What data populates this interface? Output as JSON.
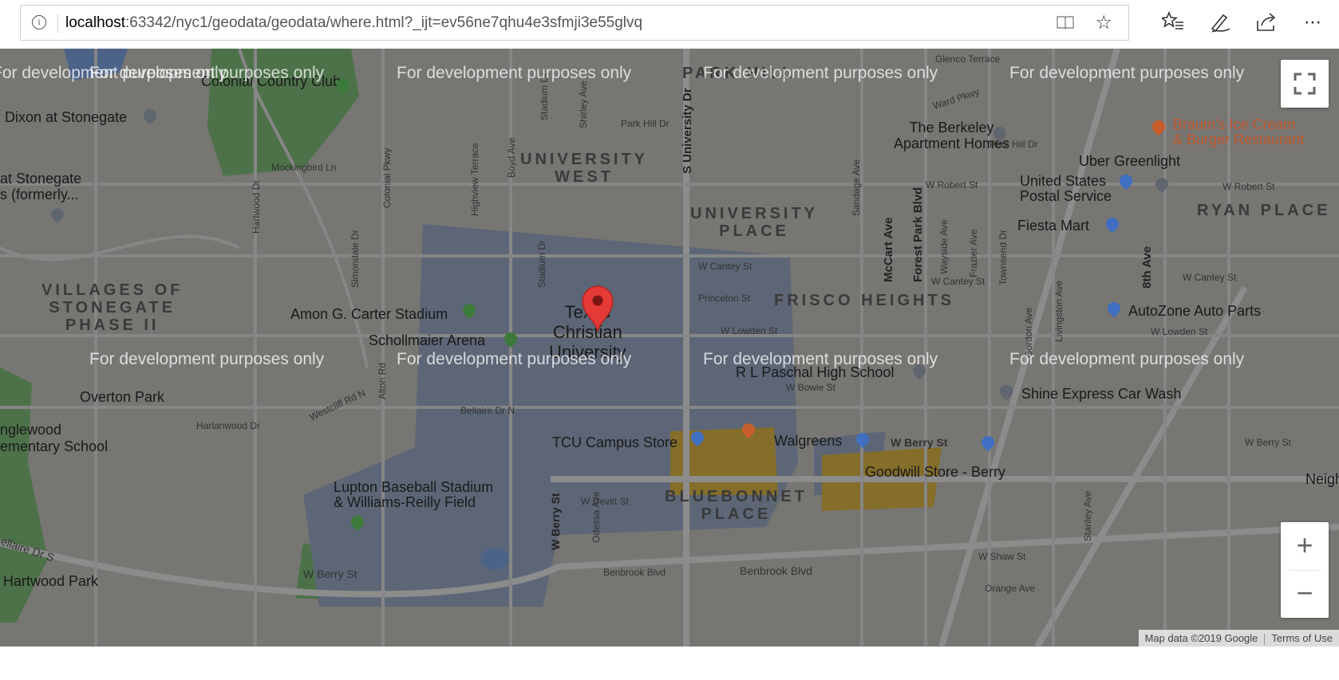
{
  "browser": {
    "url_host": "localhost",
    "url_path": ":63342/nyc1/geodata/geodata/where.html?_ijt=ev56ne7qhu4e3sfmji3e55glvq",
    "icons": [
      "info-icon",
      "reading-view-icon",
      "favorite-star-icon",
      "favorites-list-icon",
      "pen-icon",
      "share-icon",
      "more-icon"
    ]
  },
  "map": {
    "watermark": "For development purposes only",
    "areas": {
      "park_hill": "PARK HILL",
      "university_west": "UNIVERSITY\nWEST",
      "university_place": "UNIVERSITY\nPLACE",
      "ryan_place": "RYAN PLACE",
      "villages": "VILLAGES OF\nSTONEGATE\nPHASE II",
      "frisco": "FRISCO HEIGHTS",
      "bluebonnet": "BLUEBONNET\nPLACE"
    },
    "pois": {
      "colonial": "Colonial Country Club",
      "dixon": "Dixon at Stonegate",
      "stonegate": "at Stonegate\ns (formerly...",
      "berkeley": "The Berkeley\nApartment Homes",
      "braums": "Braum's Ice Cream\n& Burger Restaurant",
      "uber": "Uber Greenlight",
      "usps": "United States\nPostal Service",
      "fiesta": "Fiesta Mart",
      "amon": "Amon G. Carter Stadium",
      "schollmaier": "Schollmaier Arena",
      "tcu": "Texas\nChristian\nUniversity",
      "autozone": "AutoZone Auto Parts",
      "paschal": "R L Paschal High School",
      "shine": "Shine Express Car Wash",
      "overton": "Overton Park",
      "englewood": "nglewood\nementary School",
      "campus_store": "TCU Campus Store",
      "walgreens": "Walgreens",
      "goodwill": "Goodwill Store - Berry",
      "lupton": "Lupton Baseball Stadium\n& Williams-Reilly Field",
      "hartwood": "Hartwood Park",
      "neigh": "Neigh"
    },
    "streets": {
      "mockingbird": "Mockingbird Ln",
      "park_hill_dr": "Park Hill Dr",
      "park_hill_dr2": "Park Hill Dr",
      "glenco": "Glenco Terrace",
      "ward": "Ward Pkwy",
      "w_robert": "W Robert St",
      "w_robert2": "W Robert St",
      "w_cantey": "W Cantey St",
      "w_cantey2": "W Cantey St",
      "w_cantey3": "W Canteу St",
      "princeton": "Princeton St",
      "w_lowden": "W Lowden St",
      "w_lowden2": "W Lowden St",
      "w_bowie": "W Bowie St",
      "w_berry": "W Berry St",
      "w_berry2": "W Berry St",
      "w_berry3": "W Berry St",
      "bellaire": "Bellaire Dr N",
      "harlanwood": "Harlanwood Dr",
      "westcliff": "Westcliff Rd N",
      "w_devitt": "W Devitt St",
      "benbrook": "Benbrook Blvd",
      "benbrook2": "Benbrook Blvd",
      "w_shaw": "W Shaw St",
      "orange": "Orange Ave",
      "bellaire_s": "ellaire Dr S",
      "s_university": "S University Dr",
      "mccart": "McCart Ave",
      "forest_park": "Forest Park Blvd",
      "eighth": "8th Ave",
      "stadium": "Stadium Dr",
      "stadium2": "Stadium Dr",
      "hartwood_dr": "Hartwood Dr",
      "highview": "Highview Terrace",
      "boyd": "Boyd Ave",
      "shirley": "Shirley Ave",
      "simondale": "Simondale Dr",
      "alton": "Alton Rd",
      "w_berry_v": "W Berry St",
      "odessa": "Odessa Ave",
      "colonial_pkwy": "Colonial Pkwy",
      "sandage": "Sandage Ave",
      "wayside": "Wayside Ave",
      "frazier": "Frazier Ave",
      "townsend": "Townsend Dr",
      "livingston": "Livingston Ave",
      "gordon": "Gordon Ave",
      "stanley": "Stanley Ave"
    }
  },
  "controls": {
    "zoom_in": "+",
    "zoom_out": "−",
    "attribution": "Map data ©2019 Google",
    "terms": "Terms of Use"
  },
  "colors": {
    "overlay": "#000000",
    "marker": "#e53935",
    "campus": "#8ea4c8",
    "park": "#7cc47a",
    "commercial": "#f2c94c"
  }
}
